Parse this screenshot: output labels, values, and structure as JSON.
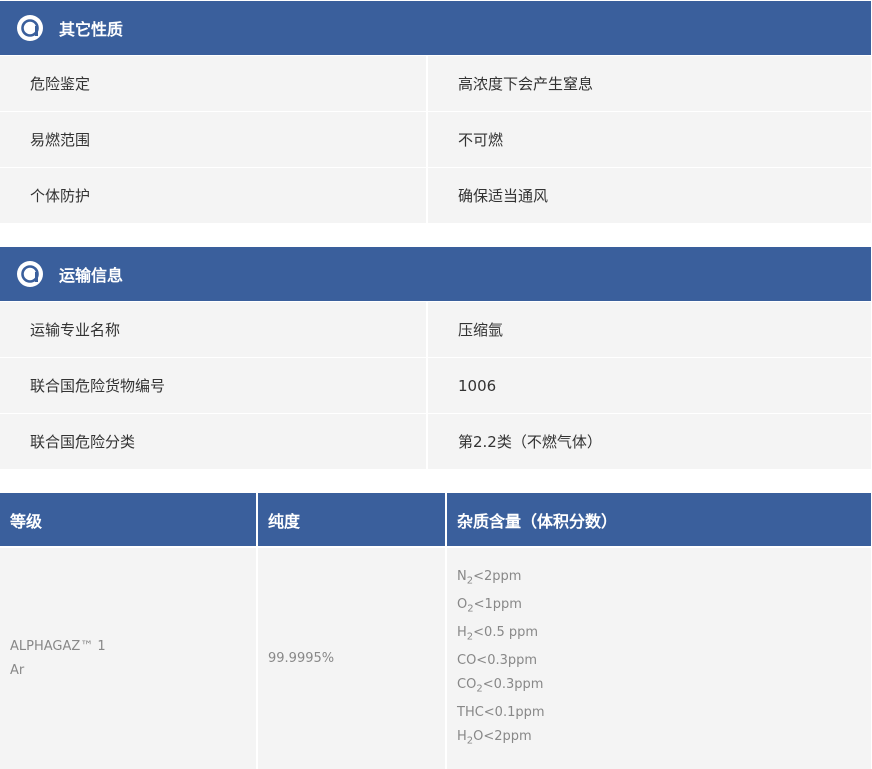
{
  "other_props": {
    "title": "其它性质",
    "rows": [
      {
        "label": "危险鉴定",
        "value": "高浓度下会产生窒息"
      },
      {
        "label": "易燃范围",
        "value": "不可燃"
      },
      {
        "label": "个体防护",
        "value": "确保适当通风"
      }
    ]
  },
  "transport": {
    "title": "运输信息",
    "rows": [
      {
        "label": "运输专业名称",
        "value": "压缩氩"
      },
      {
        "label": "联合国危险货物编号",
        "value": "1006"
      },
      {
        "label": "联合国危险分类",
        "value": "第2.2类（不燃气体）"
      }
    ]
  },
  "grade_table": {
    "headers": [
      "等级",
      "纯度",
      "杂质含量（体积分数）"
    ],
    "grade_line1": "ALPHAGAZ™ 1",
    "grade_line2": "Ar",
    "purity": "99.9995%",
    "impurities": [
      {
        "pre": "N",
        "sub": "2",
        "post": "<2ppm"
      },
      {
        "pre": "O",
        "sub": "2",
        "post": "<1ppm"
      },
      {
        "pre": "H",
        "sub": "2",
        "post": "<0.5 ppm"
      },
      {
        "pre": "CO<0.3ppm",
        "sub": "",
        "post": ""
      },
      {
        "pre": "CO",
        "sub": "2",
        "post": "<0.3ppm"
      },
      {
        "pre": "THC<0.1ppm",
        "sub": "",
        "post": ""
      },
      {
        "pre": "H",
        "sub": "2",
        "post": "O<2ppm"
      }
    ]
  },
  "colors": {
    "header_bg": "#3a5f9c",
    "row_bg": "#f4f4f4"
  },
  "icons": {
    "section_logo": "air-liquide-logo-icon"
  }
}
